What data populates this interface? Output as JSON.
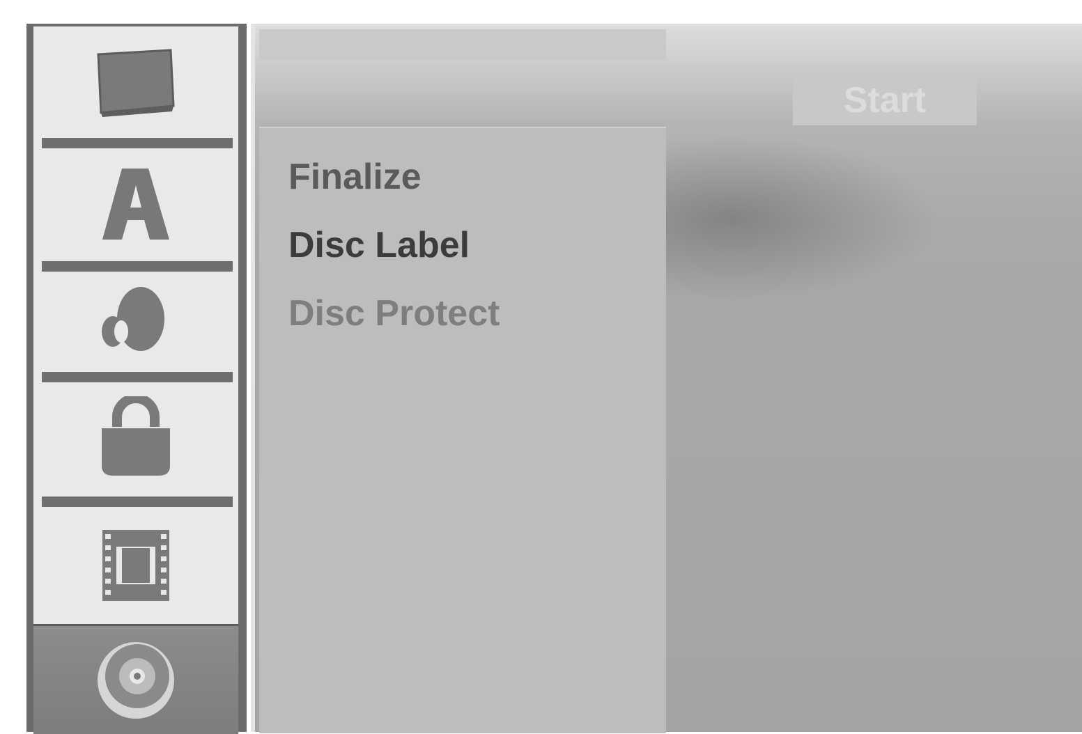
{
  "sidebar": {
    "items": [
      {
        "icon": "screen-icon",
        "active": false
      },
      {
        "icon": "language-icon",
        "active": false
      },
      {
        "icon": "audio-icon",
        "active": false
      },
      {
        "icon": "lock-icon",
        "active": false
      },
      {
        "icon": "film-icon",
        "active": false
      },
      {
        "icon": "disc-icon",
        "active": true
      }
    ]
  },
  "main": {
    "title": "",
    "start_button": "Start",
    "menu": [
      {
        "label": "Finalize",
        "state": "normal"
      },
      {
        "label": "Disc Label",
        "state": "selected"
      },
      {
        "label": "Disc Protect",
        "state": "disabled"
      }
    ]
  },
  "colors": {
    "sidebar_frame": "#6b6b6b",
    "sidebar_bg": "#e9e9e9",
    "icon_fill": "#7a7a7a",
    "active_item_bg": "#858585",
    "menu_panel_bg": "#bdbdbd",
    "start_button_bg": "#c8c8c8"
  }
}
